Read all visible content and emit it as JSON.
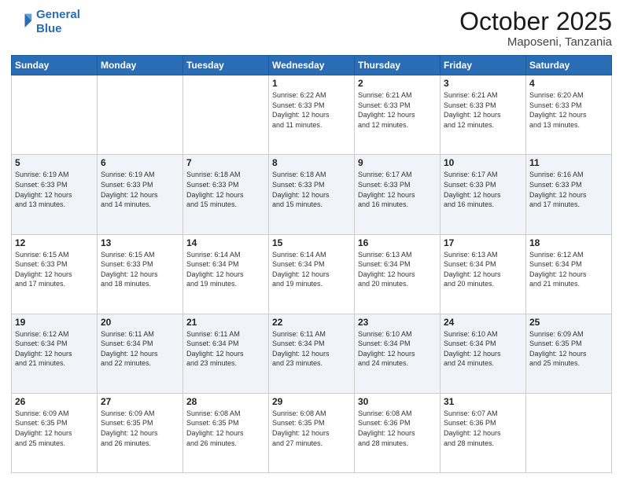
{
  "header": {
    "logo_line1": "General",
    "logo_line2": "Blue",
    "month": "October 2025",
    "location": "Maposeni, Tanzania"
  },
  "weekdays": [
    "Sunday",
    "Monday",
    "Tuesday",
    "Wednesday",
    "Thursday",
    "Friday",
    "Saturday"
  ],
  "weeks": [
    [
      {
        "day": "",
        "text": ""
      },
      {
        "day": "",
        "text": ""
      },
      {
        "day": "",
        "text": ""
      },
      {
        "day": "1",
        "text": "Sunrise: 6:22 AM\nSunset: 6:33 PM\nDaylight: 12 hours\nand 11 minutes."
      },
      {
        "day": "2",
        "text": "Sunrise: 6:21 AM\nSunset: 6:33 PM\nDaylight: 12 hours\nand 12 minutes."
      },
      {
        "day": "3",
        "text": "Sunrise: 6:21 AM\nSunset: 6:33 PM\nDaylight: 12 hours\nand 12 minutes."
      },
      {
        "day": "4",
        "text": "Sunrise: 6:20 AM\nSunset: 6:33 PM\nDaylight: 12 hours\nand 13 minutes."
      }
    ],
    [
      {
        "day": "5",
        "text": "Sunrise: 6:19 AM\nSunset: 6:33 PM\nDaylight: 12 hours\nand 13 minutes."
      },
      {
        "day": "6",
        "text": "Sunrise: 6:19 AM\nSunset: 6:33 PM\nDaylight: 12 hours\nand 14 minutes."
      },
      {
        "day": "7",
        "text": "Sunrise: 6:18 AM\nSunset: 6:33 PM\nDaylight: 12 hours\nand 15 minutes."
      },
      {
        "day": "8",
        "text": "Sunrise: 6:18 AM\nSunset: 6:33 PM\nDaylight: 12 hours\nand 15 minutes."
      },
      {
        "day": "9",
        "text": "Sunrise: 6:17 AM\nSunset: 6:33 PM\nDaylight: 12 hours\nand 16 minutes."
      },
      {
        "day": "10",
        "text": "Sunrise: 6:17 AM\nSunset: 6:33 PM\nDaylight: 12 hours\nand 16 minutes."
      },
      {
        "day": "11",
        "text": "Sunrise: 6:16 AM\nSunset: 6:33 PM\nDaylight: 12 hours\nand 17 minutes."
      }
    ],
    [
      {
        "day": "12",
        "text": "Sunrise: 6:15 AM\nSunset: 6:33 PM\nDaylight: 12 hours\nand 17 minutes."
      },
      {
        "day": "13",
        "text": "Sunrise: 6:15 AM\nSunset: 6:33 PM\nDaylight: 12 hours\nand 18 minutes."
      },
      {
        "day": "14",
        "text": "Sunrise: 6:14 AM\nSunset: 6:34 PM\nDaylight: 12 hours\nand 19 minutes."
      },
      {
        "day": "15",
        "text": "Sunrise: 6:14 AM\nSunset: 6:34 PM\nDaylight: 12 hours\nand 19 minutes."
      },
      {
        "day": "16",
        "text": "Sunrise: 6:13 AM\nSunset: 6:34 PM\nDaylight: 12 hours\nand 20 minutes."
      },
      {
        "day": "17",
        "text": "Sunrise: 6:13 AM\nSunset: 6:34 PM\nDaylight: 12 hours\nand 20 minutes."
      },
      {
        "day": "18",
        "text": "Sunrise: 6:12 AM\nSunset: 6:34 PM\nDaylight: 12 hours\nand 21 minutes."
      }
    ],
    [
      {
        "day": "19",
        "text": "Sunrise: 6:12 AM\nSunset: 6:34 PM\nDaylight: 12 hours\nand 21 minutes."
      },
      {
        "day": "20",
        "text": "Sunrise: 6:11 AM\nSunset: 6:34 PM\nDaylight: 12 hours\nand 22 minutes."
      },
      {
        "day": "21",
        "text": "Sunrise: 6:11 AM\nSunset: 6:34 PM\nDaylight: 12 hours\nand 23 minutes."
      },
      {
        "day": "22",
        "text": "Sunrise: 6:11 AM\nSunset: 6:34 PM\nDaylight: 12 hours\nand 23 minutes."
      },
      {
        "day": "23",
        "text": "Sunrise: 6:10 AM\nSunset: 6:34 PM\nDaylight: 12 hours\nand 24 minutes."
      },
      {
        "day": "24",
        "text": "Sunrise: 6:10 AM\nSunset: 6:34 PM\nDaylight: 12 hours\nand 24 minutes."
      },
      {
        "day": "25",
        "text": "Sunrise: 6:09 AM\nSunset: 6:35 PM\nDaylight: 12 hours\nand 25 minutes."
      }
    ],
    [
      {
        "day": "26",
        "text": "Sunrise: 6:09 AM\nSunset: 6:35 PM\nDaylight: 12 hours\nand 25 minutes."
      },
      {
        "day": "27",
        "text": "Sunrise: 6:09 AM\nSunset: 6:35 PM\nDaylight: 12 hours\nand 26 minutes."
      },
      {
        "day": "28",
        "text": "Sunrise: 6:08 AM\nSunset: 6:35 PM\nDaylight: 12 hours\nand 26 minutes."
      },
      {
        "day": "29",
        "text": "Sunrise: 6:08 AM\nSunset: 6:35 PM\nDaylight: 12 hours\nand 27 minutes."
      },
      {
        "day": "30",
        "text": "Sunrise: 6:08 AM\nSunset: 6:36 PM\nDaylight: 12 hours\nand 28 minutes."
      },
      {
        "day": "31",
        "text": "Sunrise: 6:07 AM\nSunset: 6:36 PM\nDaylight: 12 hours\nand 28 minutes."
      },
      {
        "day": "",
        "text": ""
      }
    ]
  ]
}
